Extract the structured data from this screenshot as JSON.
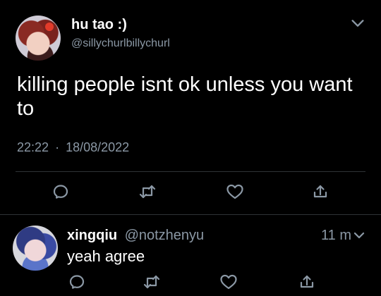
{
  "tweet": {
    "display_name": "hu tao :)",
    "handle": "@sillychurlbillychurl",
    "text": "killing people isnt ok unless you want to",
    "time": "22:22",
    "separator": "·",
    "date": "18/08/2022"
  },
  "actions": [
    "reply-icon",
    "retweet-icon",
    "like-icon",
    "share-icon"
  ],
  "reply": {
    "display_name": "xingqiu",
    "handle": "@notzhenyu",
    "time": "11 m",
    "text": "yeah agree"
  },
  "colors": {
    "background": "#000000",
    "text_primary": "#ffffff",
    "text_secondary": "#8b98a5",
    "divider": "#2f3336"
  }
}
